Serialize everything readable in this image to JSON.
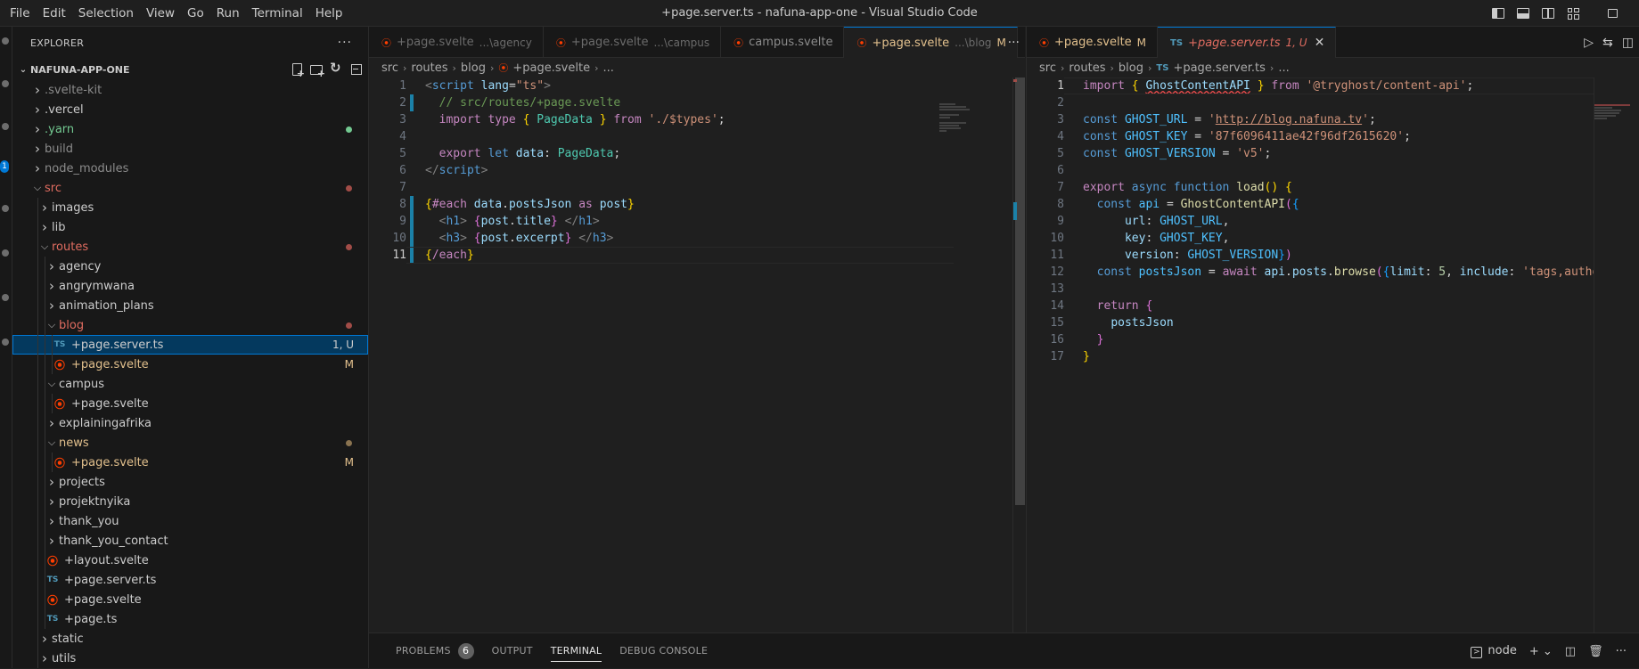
{
  "menu": [
    "File",
    "Edit",
    "Selection",
    "View",
    "Go",
    "Run",
    "Terminal",
    "Help"
  ],
  "window_title": "+page.server.ts - nafuna-app-one - Visual Studio Code",
  "activity": {
    "badge": "1"
  },
  "sidebar": {
    "title": "EXPLORER",
    "more": "···",
    "project": "NAFUNA-APP-ONE",
    "tree": [
      {
        "label": ".svelte-kit",
        "depth": 0,
        "type": "folder",
        "open": false,
        "color": "dim"
      },
      {
        "label": ".vercel",
        "depth": 0,
        "type": "folder",
        "open": false,
        "color": ""
      },
      {
        "label": ".yarn",
        "depth": 0,
        "type": "folder",
        "open": false,
        "color": "green",
        "dot": "#73c991"
      },
      {
        "label": "build",
        "depth": 0,
        "type": "folder",
        "open": false,
        "color": "dim"
      },
      {
        "label": "node_modules",
        "depth": 0,
        "type": "folder",
        "open": false,
        "color": "dim"
      },
      {
        "label": "src",
        "depth": 0,
        "type": "folder",
        "open": true,
        "color": "red",
        "dot": "#a14c47"
      },
      {
        "label": "images",
        "depth": 1,
        "type": "folder",
        "open": false,
        "color": ""
      },
      {
        "label": "lib",
        "depth": 1,
        "type": "folder",
        "open": false,
        "color": ""
      },
      {
        "label": "routes",
        "depth": 1,
        "type": "folder",
        "open": true,
        "color": "red",
        "dot": "#a14c47"
      },
      {
        "label": "agency",
        "depth": 2,
        "type": "folder",
        "open": false,
        "color": ""
      },
      {
        "label": "angrymwana",
        "depth": 2,
        "type": "folder",
        "open": false,
        "color": ""
      },
      {
        "label": "animation_plans",
        "depth": 2,
        "type": "folder",
        "open": false,
        "color": ""
      },
      {
        "label": "blog",
        "depth": 2,
        "type": "folder",
        "open": true,
        "color": "red",
        "dot": "#a14c47"
      },
      {
        "label": "+page.server.ts",
        "depth": 3,
        "type": "ts",
        "color": "",
        "badge": "1, U",
        "selected": true
      },
      {
        "label": "+page.svelte",
        "depth": 3,
        "type": "svelte",
        "color": "mod",
        "badge": "M"
      },
      {
        "label": "campus",
        "depth": 2,
        "type": "folder",
        "open": true,
        "color": ""
      },
      {
        "label": "+page.svelte",
        "depth": 3,
        "type": "svelte",
        "color": ""
      },
      {
        "label": "explainingafrika",
        "depth": 2,
        "type": "folder",
        "open": false,
        "color": ""
      },
      {
        "label": "news",
        "depth": 2,
        "type": "folder",
        "open": true,
        "color": "mod",
        "dot": "#8a7350"
      },
      {
        "label": "+page.svelte",
        "depth": 3,
        "type": "svelte",
        "color": "mod",
        "badge": "M"
      },
      {
        "label": "projects",
        "depth": 2,
        "type": "folder",
        "open": false,
        "color": ""
      },
      {
        "label": "projektnyika",
        "depth": 2,
        "type": "folder",
        "open": false,
        "color": ""
      },
      {
        "label": "thank_you",
        "depth": 2,
        "type": "folder",
        "open": false,
        "color": ""
      },
      {
        "label": "thank_you_contact",
        "depth": 2,
        "type": "folder",
        "open": false,
        "color": ""
      },
      {
        "label": "+layout.svelte",
        "depth": 2,
        "type": "svelte",
        "color": ""
      },
      {
        "label": "+page.server.ts",
        "depth": 2,
        "type": "ts",
        "color": ""
      },
      {
        "label": "+page.svelte",
        "depth": 2,
        "type": "svelte",
        "color": ""
      },
      {
        "label": "+page.ts",
        "depth": 2,
        "type": "ts",
        "color": ""
      },
      {
        "label": "static",
        "depth": 1,
        "type": "folder",
        "open": false,
        "color": ""
      },
      {
        "label": "utils",
        "depth": 1,
        "type": "folder",
        "open": false,
        "color": ""
      }
    ]
  },
  "left_editor": {
    "tabs": [
      {
        "label": "+page.svelte",
        "desc": "...\\agency",
        "active": false,
        "status": ""
      },
      {
        "label": "+page.svelte",
        "desc": "...\\campus",
        "active": false,
        "status": ""
      },
      {
        "label": "campus.svelte",
        "desc": "",
        "active": false,
        "status": ""
      },
      {
        "label": "+page.svelte",
        "desc": "...\\blog",
        "active": true,
        "status": "M"
      }
    ],
    "more": "···",
    "breadcrumb": [
      "src",
      "routes",
      "blog",
      "+page.svelte",
      "..."
    ],
    "current_line": 11
  },
  "right_editor": {
    "tabs": [
      {
        "label": "+page.svelte",
        "status": "M",
        "active": false,
        "type": "svelte"
      },
      {
        "label": "+page.server.ts",
        "status": "1, U",
        "active": true,
        "type": "ts"
      }
    ],
    "breadcrumb": [
      "src",
      "routes",
      "blog",
      "+page.server.ts",
      "..."
    ],
    "current_line": 1
  },
  "panel": {
    "tabs": [
      {
        "label": "PROBLEMS",
        "count": "6",
        "active": false
      },
      {
        "label": "OUTPUT",
        "active": false
      },
      {
        "label": "TERMINAL",
        "active": true
      },
      {
        "label": "DEBUG CONSOLE",
        "active": false
      }
    ],
    "terminal_name": "node"
  },
  "colors": {
    "accent": "#0078d4",
    "svelte": "#ff3e00",
    "ts": "#519aba"
  }
}
